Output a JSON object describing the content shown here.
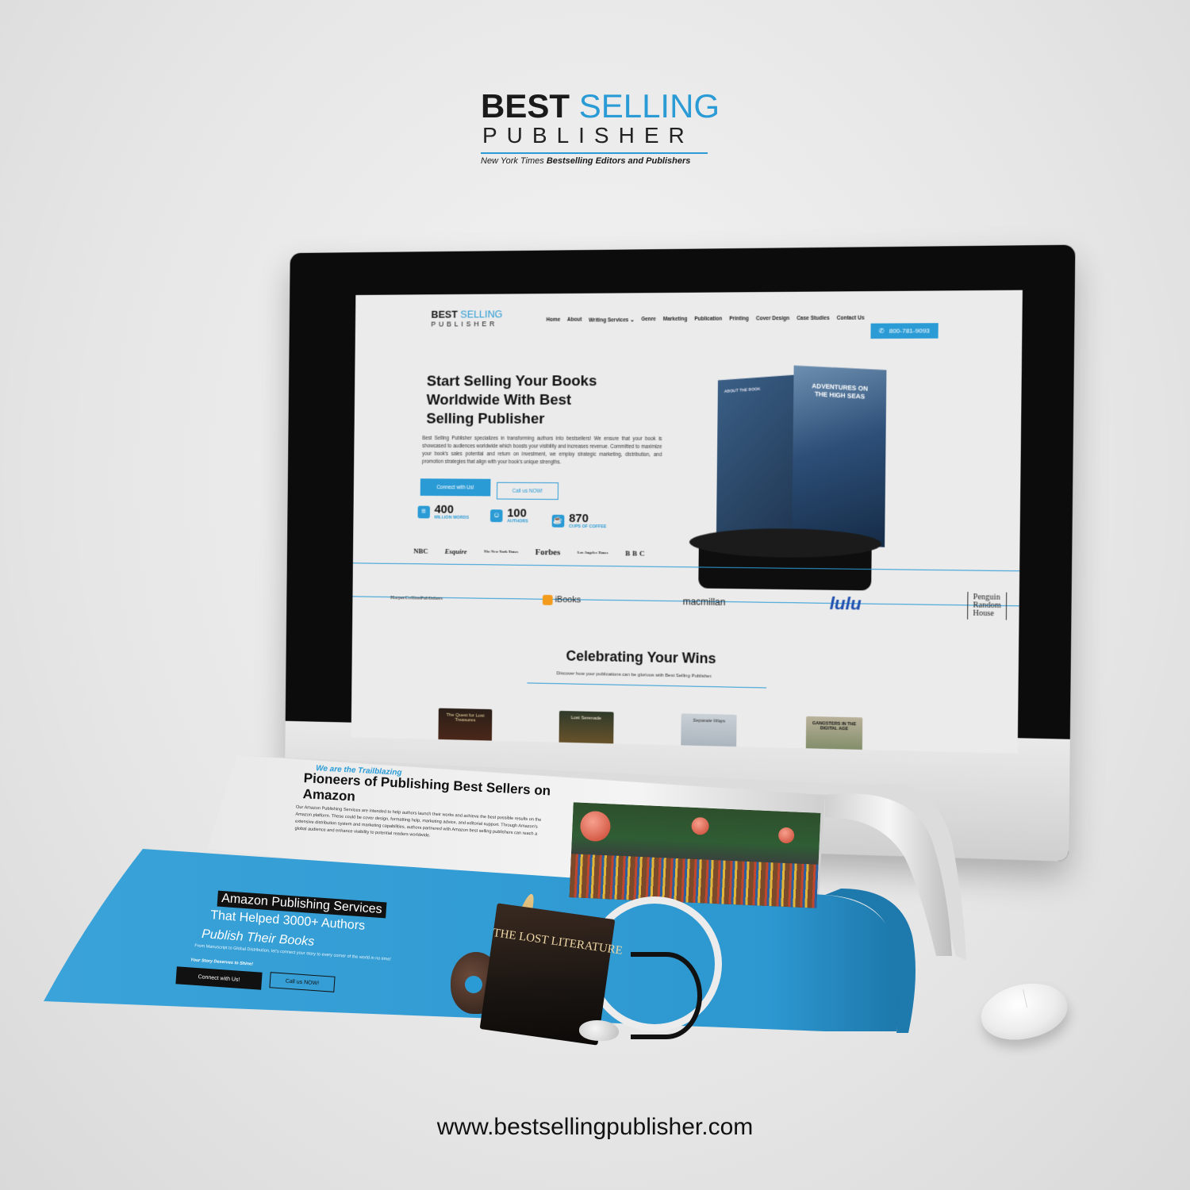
{
  "brand": {
    "line1_a": "BEST",
    "line1_b": "SELLING",
    "line2": "PUBLISHER",
    "tagline_a": "New York Times",
    "tagline_b": "Bestselling Editors and Publishers"
  },
  "screen": {
    "logo_a": "BEST",
    "logo_b": "SELLING",
    "logo_c": "PUBLISHER",
    "nav": [
      "Home",
      "About",
      "Writing Services ⌄",
      "Genre",
      "Marketing",
      "Publication",
      "Printing",
      "Cover Design",
      "Case Studies",
      "Contact Us"
    ],
    "phone": "800-781-9093",
    "hero_title": "Start Selling Your Books Worldwide With Best Selling Publisher",
    "hero_paragraph": "Best Selling Publisher specializes in transforming authors into bestsellers! We ensure that your book is showcased to audiences worldwide which boosts your visibility and increases revenue. Committed to maximize your book's sales potential and return on investment, we employ strategic marketing, distribution, and promotion strategies that align with your book's unique strengths.",
    "btn_connect": "Connect with Us!",
    "btn_call": "Call us NOW!",
    "stats": [
      {
        "num": "400",
        "label": "MILLION WORDS"
      },
      {
        "num": "100",
        "label": "AUTHORS"
      },
      {
        "num": "870",
        "label": "CUPS OF COFFEE"
      }
    ],
    "press": [
      "NBC",
      "Esquire",
      "The New York Times",
      "Forbes",
      "Los Angeles Times",
      "BBC"
    ],
    "hero_book_front": "ADVENTURES ON THE HIGH SEAS",
    "hero_book_back": "ABOUT THE BOOK",
    "partners": {
      "harper": "HarperCollinsPublishers",
      "ibooks": "iBooks",
      "macmillan": "macmillan",
      "lulu": "lulu",
      "penguin_1": "Penguin",
      "penguin_2": "Random",
      "penguin_3": "House"
    },
    "wins_title": "Celebrating Your Wins",
    "wins_sub": "Discover how your publications can be glorious with Best Selling Publisher.",
    "wins_books": [
      "The Quest for Lost Treasures",
      "Lost Serenade",
      "Separate Ways",
      "GANGSTERS IN THE DIGITAL AGE"
    ]
  },
  "paper": {
    "kicker": "We are the Trailblazing",
    "heading": "Pioneers of Publishing Best Sellers on Amazon",
    "body": "Our Amazon Publishing Services are intended to help authors launch their works and achieve the best possible results on the Amazon platform. These could be cover design, formatting help, marketing advice, and editorial support. Through Amazon's extensive distribution system and marketing capabilities, authors partnered with Amazon best selling publishers can reach a global audience and enhance visibility to potential readers worldwide.",
    "amz_title": "Amazon Publishing Services",
    "amz_line2": "That Helped 3000+ Authors",
    "amz_line3": "Publish Their Books",
    "amz_p": "From Manuscript to Global Distribution, let's connect your story to every corner of the world in no time!",
    "amz_p2": "Your Story Deserves to Shine!",
    "btn_connect": "Connect with Us!",
    "btn_call": "Call us NOW!",
    "book_title": "THE LOST LITERATURE"
  },
  "url": "www.bestsellingpublisher.com",
  "colors": {
    "accent": "#2b9bd6",
    "dark": "#111111",
    "background": "#e8e8e8"
  }
}
